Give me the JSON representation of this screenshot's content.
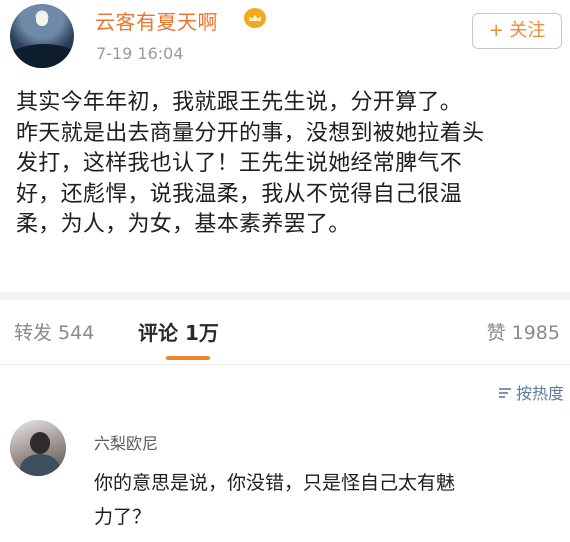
{
  "post": {
    "author": "云客有夏天啊",
    "timestamp": "7-19 16:04",
    "follow_label": "+ 关注",
    "body": "其实今年年初，我就跟王先生说，分开算了。\n昨天就是出去商量分开的事，没想到被她拉着头\n发打，这样我也认了！王先生说她经常脾气不\n好，还彪悍，说我温柔，我从不觉得自己很温\n柔，为人，为女，基本素养罢了。"
  },
  "stats": {
    "repost": "转发 544",
    "comment": "评论 1万",
    "like": "赞 1985"
  },
  "sort": {
    "label": "按热度"
  },
  "comment": {
    "author": "六梨欧尼",
    "text": "你的意思是说，你没错，只是怪自己太有魅\n力了？"
  },
  "colors": {
    "accent": "#f0742c",
    "link": "#5b7da3",
    "muted": "#9a9a9a"
  },
  "icons": {
    "crown": "crown-icon",
    "sort": "sort-icon"
  }
}
